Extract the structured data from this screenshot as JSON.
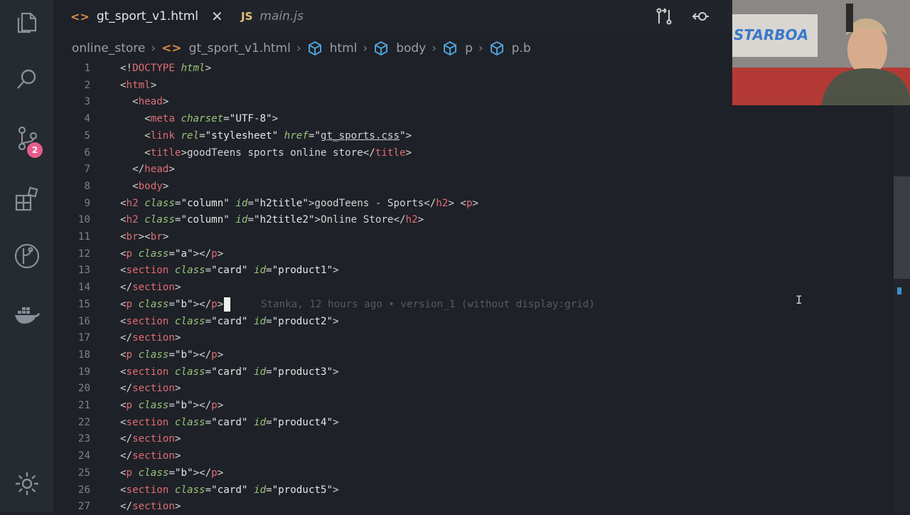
{
  "tabs": [
    {
      "label": "gt_sport_v1.html",
      "active": true,
      "icon": "html-icon"
    },
    {
      "label": "main.js",
      "active": false,
      "icon": "js-icon",
      "icon_text": "JS"
    }
  ],
  "breadcrumbs": [
    "online_store",
    "gt_sport_v1.html",
    "html",
    "body",
    "p",
    "p.b"
  ],
  "scm_badge": "2",
  "blame": "Stanka, 12 hours ago • version_1 (without display:grid)",
  "colors": {
    "tag": "#e06c75",
    "attr": "#98c379",
    "badge": "#e85b8a",
    "background": "#1e2127"
  },
  "lines": [
    {
      "n": "1",
      "segs": [
        [
          "p",
          "<!"
        ],
        [
          "t",
          "DOCTYPE"
        ],
        [
          "p",
          " "
        ],
        [
          "a",
          "html"
        ],
        [
          "p",
          ">"
        ]
      ]
    },
    {
      "n": "2",
      "segs": [
        [
          "p",
          "<"
        ],
        [
          "t",
          "html"
        ],
        [
          "p",
          ">"
        ]
      ]
    },
    {
      "n": "3",
      "segs": [
        [
          "p",
          "  <"
        ],
        [
          "t",
          "head"
        ],
        [
          "p",
          ">"
        ]
      ]
    },
    {
      "n": "4",
      "segs": [
        [
          "p",
          "    <"
        ],
        [
          "t",
          "meta"
        ],
        [
          "p",
          " "
        ],
        [
          "a",
          "charset"
        ],
        [
          "p",
          "="
        ],
        [
          "s",
          "\"UTF-8\""
        ],
        [
          "p",
          ">"
        ]
      ]
    },
    {
      "n": "5",
      "segs": [
        [
          "p",
          "    <"
        ],
        [
          "t",
          "link"
        ],
        [
          "p",
          " "
        ],
        [
          "a",
          "rel"
        ],
        [
          "p",
          "="
        ],
        [
          "s",
          "\"stylesheet\""
        ],
        [
          "p",
          " "
        ],
        [
          "a",
          "href"
        ],
        [
          "p",
          "="
        ],
        [
          "s",
          "\""
        ],
        [
          "u",
          "gt_sports.css"
        ],
        [
          "s",
          "\""
        ],
        [
          "p",
          ">"
        ]
      ]
    },
    {
      "n": "6",
      "segs": [
        [
          "p",
          "    <"
        ],
        [
          "t",
          "title"
        ],
        [
          "p",
          ">goodTeens sports online store</"
        ],
        [
          "t",
          "title"
        ],
        [
          "p",
          ">"
        ]
      ]
    },
    {
      "n": "7",
      "segs": [
        [
          "p",
          "  </"
        ],
        [
          "t",
          "head"
        ],
        [
          "p",
          ">"
        ]
      ]
    },
    {
      "n": "8",
      "segs": [
        [
          "p",
          "  <"
        ],
        [
          "t",
          "body"
        ],
        [
          "p",
          ">"
        ]
      ]
    },
    {
      "n": "9",
      "segs": [
        [
          "p",
          "<"
        ],
        [
          "t",
          "h2"
        ],
        [
          "p",
          " "
        ],
        [
          "a",
          "class"
        ],
        [
          "p",
          "="
        ],
        [
          "s",
          "\"column\""
        ],
        [
          "p",
          " "
        ],
        [
          "a",
          "id"
        ],
        [
          "p",
          "="
        ],
        [
          "s",
          "\"h2title\""
        ],
        [
          "p",
          ">goodTeens - Sports</"
        ],
        [
          "t",
          "h2"
        ],
        [
          "p",
          "> <"
        ],
        [
          "t",
          "p"
        ],
        [
          "p",
          ">"
        ]
      ]
    },
    {
      "n": "10",
      "segs": [
        [
          "p",
          "<"
        ],
        [
          "t",
          "h2"
        ],
        [
          "p",
          " "
        ],
        [
          "a",
          "class"
        ],
        [
          "p",
          "="
        ],
        [
          "s",
          "\"column\""
        ],
        [
          "p",
          " "
        ],
        [
          "a",
          "id"
        ],
        [
          "p",
          "="
        ],
        [
          "s",
          "\"h2title2\""
        ],
        [
          "p",
          ">Online Store</"
        ],
        [
          "t",
          "h2"
        ],
        [
          "p",
          ">"
        ]
      ]
    },
    {
      "n": "11",
      "segs": [
        [
          "p",
          "<"
        ],
        [
          "t",
          "br"
        ],
        [
          "p",
          "><"
        ],
        [
          "t",
          "br"
        ],
        [
          "p",
          ">"
        ]
      ]
    },
    {
      "n": "12",
      "segs": [
        [
          "p",
          "<"
        ],
        [
          "t",
          "p"
        ],
        [
          "p",
          " "
        ],
        [
          "a",
          "class"
        ],
        [
          "p",
          "="
        ],
        [
          "s",
          "\"a\""
        ],
        [
          "p",
          "></"
        ],
        [
          "t",
          "p"
        ],
        [
          "p",
          ">"
        ]
      ]
    },
    {
      "n": "13",
      "segs": [
        [
          "p",
          "<"
        ],
        [
          "t",
          "section"
        ],
        [
          "p",
          " "
        ],
        [
          "a",
          "class"
        ],
        [
          "p",
          "="
        ],
        [
          "s",
          "\"card\""
        ],
        [
          "p",
          " "
        ],
        [
          "a",
          "id"
        ],
        [
          "p",
          "="
        ],
        [
          "s",
          "\"product1\""
        ],
        [
          "p",
          ">"
        ]
      ]
    },
    {
      "n": "14",
      "segs": [
        [
          "p",
          "</"
        ],
        [
          "t",
          "section"
        ],
        [
          "p",
          ">"
        ]
      ]
    },
    {
      "n": "15",
      "segs": [
        [
          "p",
          "<"
        ],
        [
          "t",
          "p"
        ],
        [
          "p",
          " "
        ],
        [
          "a",
          "class"
        ],
        [
          "p",
          "="
        ],
        [
          "s",
          "\"b\""
        ],
        [
          "p",
          "></"
        ],
        [
          "t",
          "p"
        ],
        [
          "p",
          ">"
        ]
      ],
      "cursor": true
    },
    {
      "n": "16",
      "segs": [
        [
          "p",
          "<"
        ],
        [
          "t",
          "section"
        ],
        [
          "p",
          " "
        ],
        [
          "a",
          "class"
        ],
        [
          "p",
          "="
        ],
        [
          "s",
          "\"card\""
        ],
        [
          "p",
          " "
        ],
        [
          "a",
          "id"
        ],
        [
          "p",
          "="
        ],
        [
          "s",
          "\"product2\""
        ],
        [
          "p",
          ">"
        ]
      ]
    },
    {
      "n": "17",
      "segs": [
        [
          "p",
          "</"
        ],
        [
          "t",
          "section"
        ],
        [
          "p",
          ">"
        ]
      ]
    },
    {
      "n": "18",
      "segs": [
        [
          "p",
          "<"
        ],
        [
          "t",
          "p"
        ],
        [
          "p",
          " "
        ],
        [
          "a",
          "class"
        ],
        [
          "p",
          "="
        ],
        [
          "s",
          "\"b\""
        ],
        [
          "p",
          "></"
        ],
        [
          "t",
          "p"
        ],
        [
          "p",
          ">"
        ]
      ]
    },
    {
      "n": "19",
      "segs": [
        [
          "p",
          "<"
        ],
        [
          "t",
          "section"
        ],
        [
          "p",
          " "
        ],
        [
          "a",
          "class"
        ],
        [
          "p",
          "="
        ],
        [
          "s",
          "\"card\""
        ],
        [
          "p",
          " "
        ],
        [
          "a",
          "id"
        ],
        [
          "p",
          "="
        ],
        [
          "s",
          "\"product3\""
        ],
        [
          "p",
          ">"
        ]
      ]
    },
    {
      "n": "20",
      "segs": [
        [
          "p",
          "</"
        ],
        [
          "t",
          "section"
        ],
        [
          "p",
          ">"
        ]
      ]
    },
    {
      "n": "21",
      "segs": [
        [
          "p",
          "<"
        ],
        [
          "t",
          "p"
        ],
        [
          "p",
          " "
        ],
        [
          "a",
          "class"
        ],
        [
          "p",
          "="
        ],
        [
          "s",
          "\"b\""
        ],
        [
          "p",
          "></"
        ],
        [
          "t",
          "p"
        ],
        [
          "p",
          ">"
        ]
      ]
    },
    {
      "n": "22",
      "segs": [
        [
          "p",
          "<"
        ],
        [
          "t",
          "section"
        ],
        [
          "p",
          " "
        ],
        [
          "a",
          "class"
        ],
        [
          "p",
          "="
        ],
        [
          "s",
          "\"card\""
        ],
        [
          "p",
          " "
        ],
        [
          "a",
          "id"
        ],
        [
          "p",
          "="
        ],
        [
          "s",
          "\"product4\""
        ],
        [
          "p",
          ">"
        ]
      ]
    },
    {
      "n": "23",
      "segs": [
        [
          "p",
          "</"
        ],
        [
          "t",
          "section"
        ],
        [
          "p",
          ">"
        ]
      ]
    },
    {
      "n": "24",
      "segs": [
        [
          "p",
          "</"
        ],
        [
          "t",
          "section"
        ],
        [
          "p",
          ">"
        ]
      ]
    },
    {
      "n": "25",
      "segs": [
        [
          "p",
          "<"
        ],
        [
          "t",
          "p"
        ],
        [
          "p",
          " "
        ],
        [
          "a",
          "class"
        ],
        [
          "p",
          "="
        ],
        [
          "s",
          "\"b\""
        ],
        [
          "p",
          "></"
        ],
        [
          "t",
          "p"
        ],
        [
          "p",
          ">"
        ]
      ]
    },
    {
      "n": "26",
      "segs": [
        [
          "p",
          "<"
        ],
        [
          "t",
          "section"
        ],
        [
          "p",
          " "
        ],
        [
          "a",
          "class"
        ],
        [
          "p",
          "="
        ],
        [
          "s",
          "\"card\""
        ],
        [
          "p",
          " "
        ],
        [
          "a",
          "id"
        ],
        [
          "p",
          "="
        ],
        [
          "s",
          "\"product5\""
        ],
        [
          "p",
          ">"
        ]
      ]
    },
    {
      "n": "27",
      "segs": [
        [
          "p",
          "</"
        ],
        [
          "t",
          "section"
        ],
        [
          "p",
          ">"
        ]
      ]
    }
  ]
}
